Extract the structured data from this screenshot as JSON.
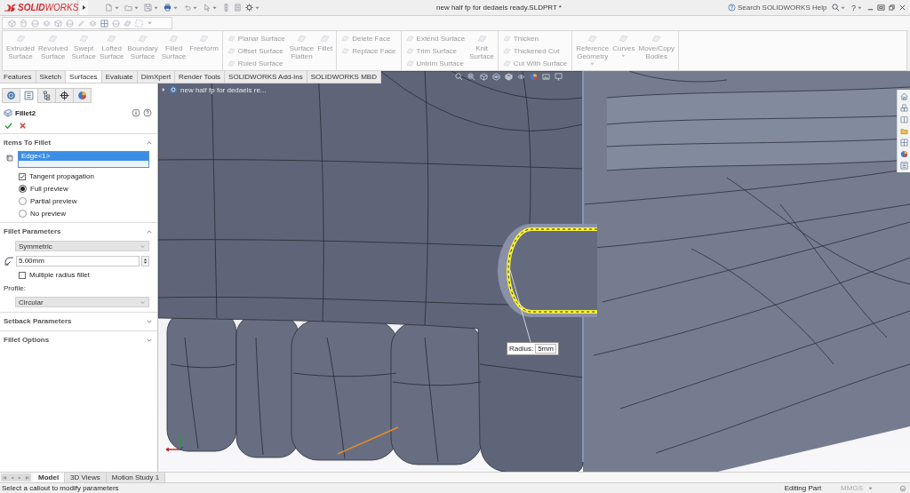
{
  "title_bar": {
    "logo": "**SOLID**WORKS",
    "document_title": "new half fp for dedaels ready.SLDPRT *",
    "search_placeholder": "Search SOLIDWORKS Help",
    "help_menu": "?"
  },
  "ribbon": [
    {
      "columns": [
        {
          "kind": "large",
          "label": "Extruded Surface",
          "disabled": true,
          "dropdown": false
        },
        {
          "kind": "large",
          "label": "Revolved Surface",
          "disabled": true,
          "dropdown": false
        },
        {
          "kind": "large",
          "label": "Swept Surface",
          "disabled": true,
          "dropdown": false
        },
        {
          "kind": "large",
          "label": "Lofted Surface",
          "disabled": true,
          "dropdown": false
        },
        {
          "kind": "large",
          "label": "Boundary Surface",
          "disabled": true,
          "dropdown": false
        },
        {
          "kind": "large",
          "label": "Filled Surface",
          "disabled": true,
          "dropdown": false
        },
        {
          "kind": "large",
          "label": "Freeform",
          "disabled": true,
          "dropdown": false
        }
      ]
    },
    {
      "columns": [
        {
          "kind": "stack",
          "items": [
            {
              "label": "Planar Surface",
              "disabled": true
            },
            {
              "label": "Offset Surface",
              "disabled": true
            },
            {
              "label": "Ruled Surface",
              "disabled": true
            }
          ]
        },
        {
          "kind": "large",
          "label": "Surface Flatten",
          "disabled": true,
          "dropdown": false
        },
        {
          "kind": "large",
          "label": "Fillet",
          "disabled": true,
          "dropdown": false
        }
      ]
    },
    {
      "columns": [
        {
          "kind": "stack",
          "items": [
            {
              "label": "Delete Face",
              "disabled": true
            },
            {
              "label": "Replace Face",
              "disabled": true
            }
          ]
        }
      ]
    },
    {
      "columns": [
        {
          "kind": "stack",
          "items": [
            {
              "label": "Extend Surface",
              "disabled": true
            },
            {
              "label": "Trim Surface",
              "disabled": true
            },
            {
              "label": "Untrim Surface",
              "disabled": true
            }
          ]
        },
        {
          "kind": "large",
          "label": "Knit Surface",
          "disabled": true,
          "dropdown": false
        }
      ]
    },
    {
      "columns": [
        {
          "kind": "stack",
          "items": [
            {
              "label": "Thicken",
              "disabled": true
            },
            {
              "label": "Thickened Cut",
              "disabled": true
            },
            {
              "label": "Cut With Surface",
              "disabled": true
            }
          ]
        }
      ]
    },
    {
      "columns": [
        {
          "kind": "large",
          "label": "Reference Geometry",
          "disabled": true,
          "dropdown": true
        },
        {
          "kind": "large",
          "label": "Curves",
          "disabled": true,
          "dropdown": true
        },
        {
          "kind": "large",
          "label": "Move/Copy Bodies",
          "disabled": true,
          "dropdown": false
        }
      ]
    }
  ],
  "command_tabs": [
    {
      "label": "Features",
      "selected": false
    },
    {
      "label": "Sketch",
      "selected": false
    },
    {
      "label": "Surfaces",
      "selected": true
    },
    {
      "label": "Evaluate",
      "selected": false
    },
    {
      "label": "DimXpert",
      "selected": false
    },
    {
      "label": "Render Tools",
      "selected": false
    },
    {
      "label": "SOLIDWORKS Add-Ins",
      "selected": false
    },
    {
      "label": "SOLIDWORKS MBD",
      "selected": false
    }
  ],
  "panel": {
    "tabs": [
      {
        "kind": "tree",
        "selected": false
      },
      {
        "kind": "properties",
        "selected": true
      },
      {
        "kind": "configurations",
        "selected": false
      },
      {
        "kind": "target",
        "selected": false
      },
      {
        "kind": "display",
        "selected": false
      }
    ],
    "title": "Fillet2",
    "sections": [
      {
        "title": "Items To Fillet",
        "expanded": true,
        "selection": [
          {
            "label": "Edge<1>",
            "selected": true
          }
        ],
        "checkboxes": [
          {
            "label": "Tangent propagation",
            "checked": true
          }
        ],
        "radios": [
          {
            "label": "Full preview",
            "selected": true
          },
          {
            "label": "Partial preview",
            "selected": false
          },
          {
            "label": "No preview",
            "selected": false
          }
        ]
      },
      {
        "title": "Fillet Parameters",
        "expanded": true,
        "method": "Symmetric",
        "radius": "5.00mm",
        "checkboxes": [
          {
            "label": "Multiple radius fillet",
            "checked": false
          }
        ],
        "profile_label": "Profile:",
        "profile": "Circular"
      },
      {
        "title": "Setback Parameters",
        "expanded": false
      },
      {
        "title": "Fillet Options",
        "expanded": false
      }
    ]
  },
  "viewport": {
    "tree_label": "new half fp for dedaels re...",
    "callout": {
      "label": "Radius:",
      "value": "5mm"
    }
  },
  "model_tabs": [
    {
      "label": "Model",
      "selected": true
    },
    {
      "label": "3D Views",
      "selected": false
    },
    {
      "label": "Motion Study 1",
      "selected": false
    }
  ],
  "status_bar": {
    "message": "Select a callout to modify parameters",
    "mode": "Editing Part",
    "units": {
      "label": "MMGS",
      "disabled": true
    }
  }
}
